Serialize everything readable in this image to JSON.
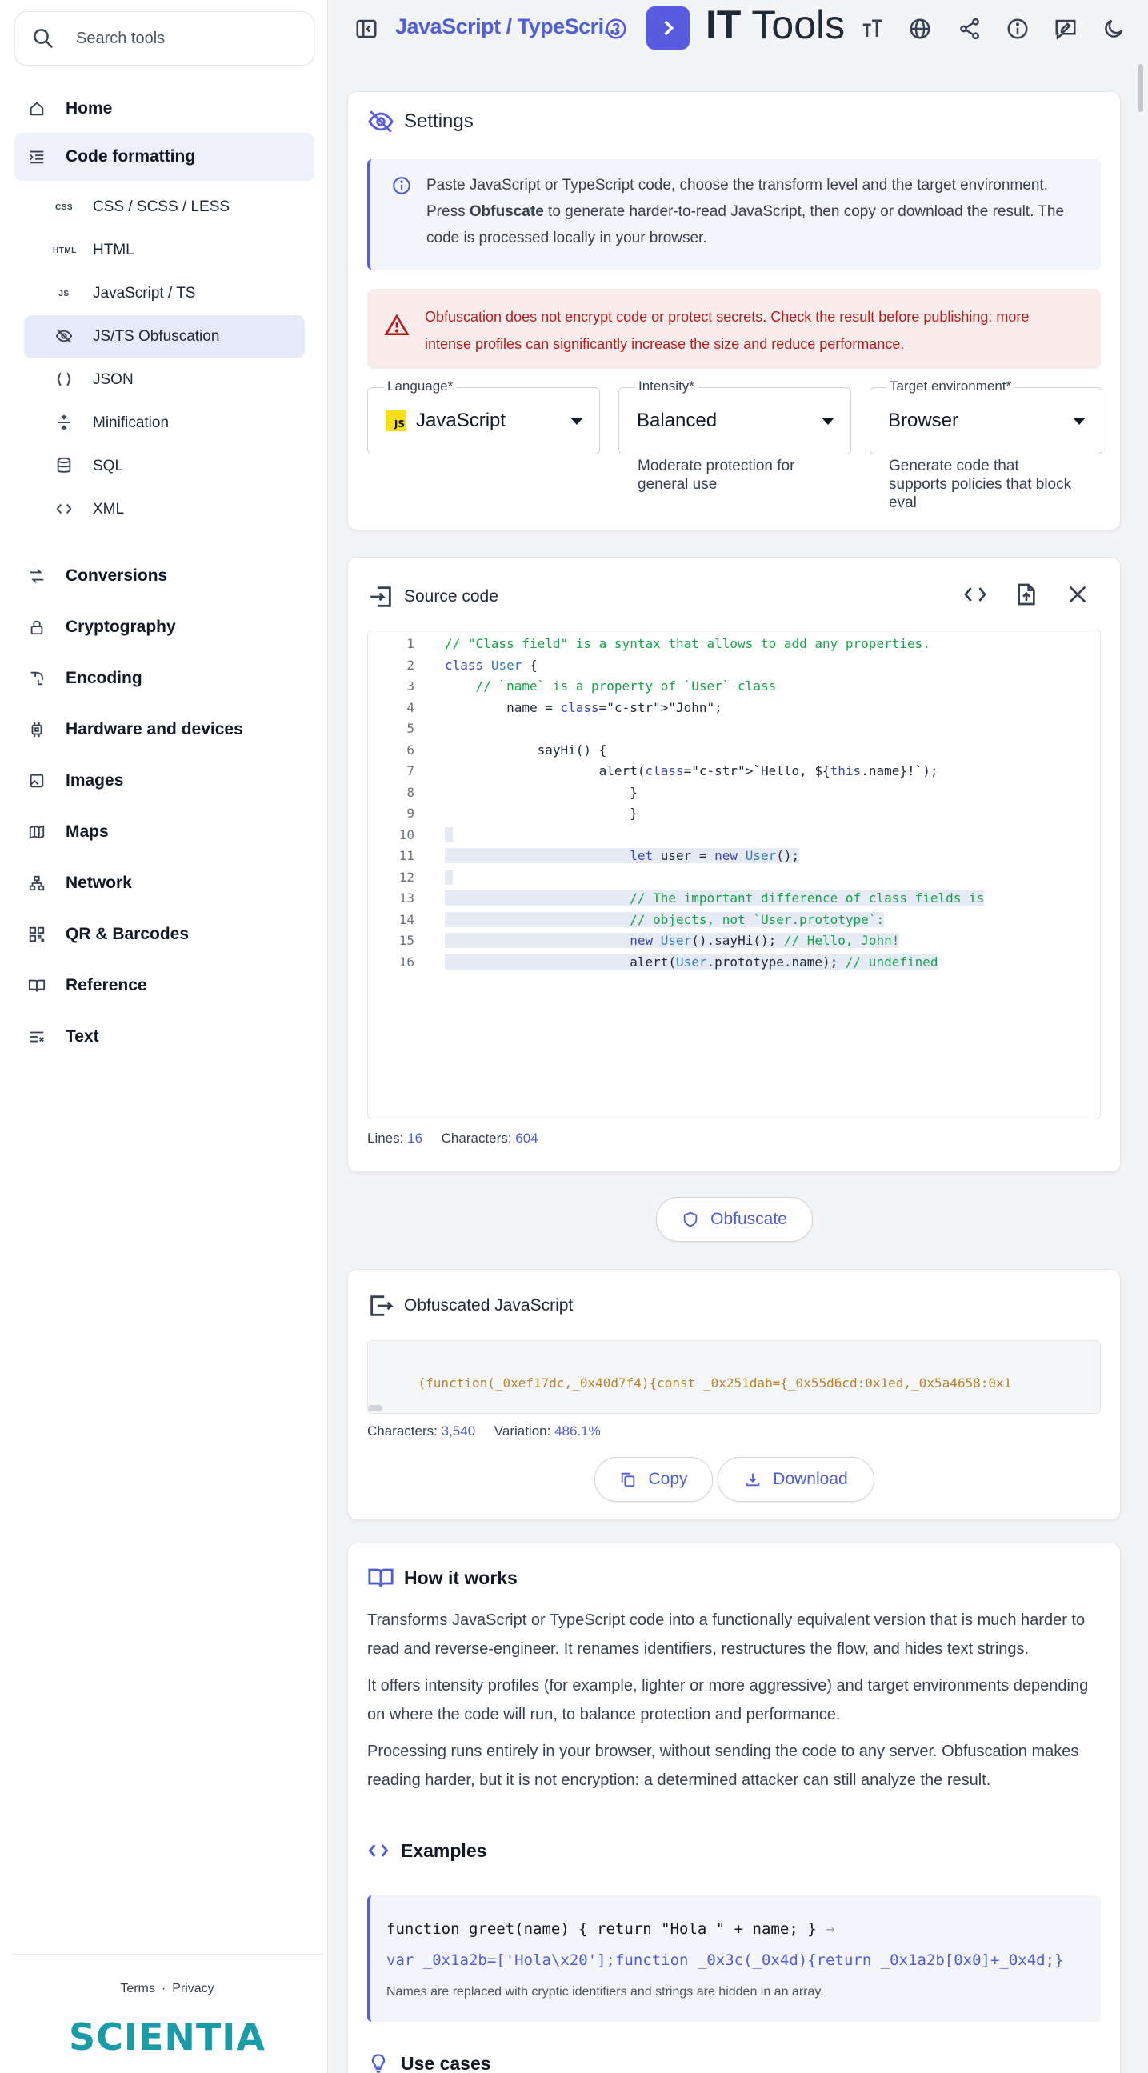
{
  "sidebar": {
    "search_placeholder": "Search tools",
    "home": "Home",
    "code_formatting": "Code formatting",
    "sub_items": [
      {
        "badge": "CSS",
        "label": "CSS / SCSS / LESS"
      },
      {
        "badge": "HTML",
        "label": "HTML"
      },
      {
        "badge": "JS",
        "label": "JavaScript / TS"
      },
      {
        "badge": "",
        "label": "JS/TS Obfuscation"
      },
      {
        "badge": "",
        "label": "JSON"
      },
      {
        "badge": "",
        "label": "Minification"
      },
      {
        "badge": "",
        "label": "SQL"
      },
      {
        "badge": "",
        "label": "XML"
      }
    ],
    "categories": [
      "Conversions",
      "Cryptography",
      "Encoding",
      "Hardware and devices",
      "Images",
      "Maps",
      "Network",
      "QR & Barcodes",
      "Reference",
      "Text"
    ],
    "footer_terms": "Terms",
    "footer_sep": "·",
    "footer_privacy": "Privacy",
    "logo_text": "SCIENTIA"
  },
  "topbar": {
    "breadcrumb": "JavaScript / TypeScri...",
    "brand_bold": "IT",
    "brand_light": " Tools"
  },
  "settings": {
    "title": "Settings",
    "info_pre": "Paste JavaScript or TypeScript code, choose the transform level and the target environment. Press ",
    "info_bold": "Obfuscate",
    "info_post": " to generate harder-to-read JavaScript, then copy or download the result. The code is processed locally in your browser.",
    "warning": "Obfuscation does not encrypt code or protect secrets. Check the result before publishing: more intense profiles can significantly increase the size and reduce performance.",
    "language_label": "Language*",
    "language_badge": "JS",
    "language_value": "JavaScript",
    "intensity_label": "Intensity*",
    "intensity_value": "Balanced",
    "intensity_hint": "Moderate protection for general use",
    "target_label": "Target environment*",
    "target_value": "Browser",
    "target_hint": "Generate code that supports policies that block eval"
  },
  "source": {
    "title": "Source code",
    "lines_label": "Lines:",
    "lines_value": "16",
    "chars_label": "Characters:",
    "chars_value": "604",
    "code_lines": [
      "// \"Class field\" is a syntax that allows to add any properties.",
      "class User {",
      "    // `name` is a property of `User` class",
      "        name = \"John\";",
      "",
      "            sayHi() {",
      "                    alert(`Hello, ${this.name}!`);",
      "                        }",
      "                        }",
      "",
      "                        let user = new User();",
      "",
      "                        // The important difference of class fields is",
      "                        // objects, not `User.prototype`:",
      "                        new User().sayHi(); // Hello, John!",
      "                        alert(User.prototype.name); // undefined"
    ]
  },
  "actions": {
    "obfuscate": "Obfuscate"
  },
  "output": {
    "title": "Obfuscated JavaScript",
    "code": "(function(_0xef17dc,_0x40d7f4){const _0x251dab={_0x55d6cd:0x1ed,_0x5a4658:0x1",
    "chars_label": "Characters:",
    "chars_value": "3,540",
    "variation_label": "Variation:",
    "variation_value": "486.1%",
    "copy": "Copy",
    "download": "Download"
  },
  "how": {
    "title": "How it works",
    "p1": "Transforms JavaScript or TypeScript code into a functionally equivalent version that is much harder to read and reverse-engineer. It renames identifiers, restructures the flow, and hides text strings.",
    "p2": "It offers intensity profiles (for example, lighter or more aggressive) and target environments depending on where the code will run, to balance protection and performance.",
    "p3": "Processing runs entirely in your browser, without sending the code to any server. Obfuscation makes reading harder, but it is not encryption: a determined attacker can still analyze the result.",
    "examples_title": "Examples",
    "ex_input": "function greet(name) { return \"Hola \" + name; }",
    "ex_arrow": "→",
    "ex_output": "var _0x1a2b=['Hola\\x20'];function _0x3c(_0x4d){return _0x1a2b[0x0]+_0x4d;}",
    "ex_note": "Names are replaced with cryptic identifiers and strings are hidden in an array.",
    "use_cases_title": "Use cases"
  },
  "colors": {
    "accent": "#5a5ce0",
    "link": "#4f5fd6",
    "warning_text": "#b91c1c",
    "warning_bg": "#fbecec",
    "logo": "#1a9ba8"
  }
}
